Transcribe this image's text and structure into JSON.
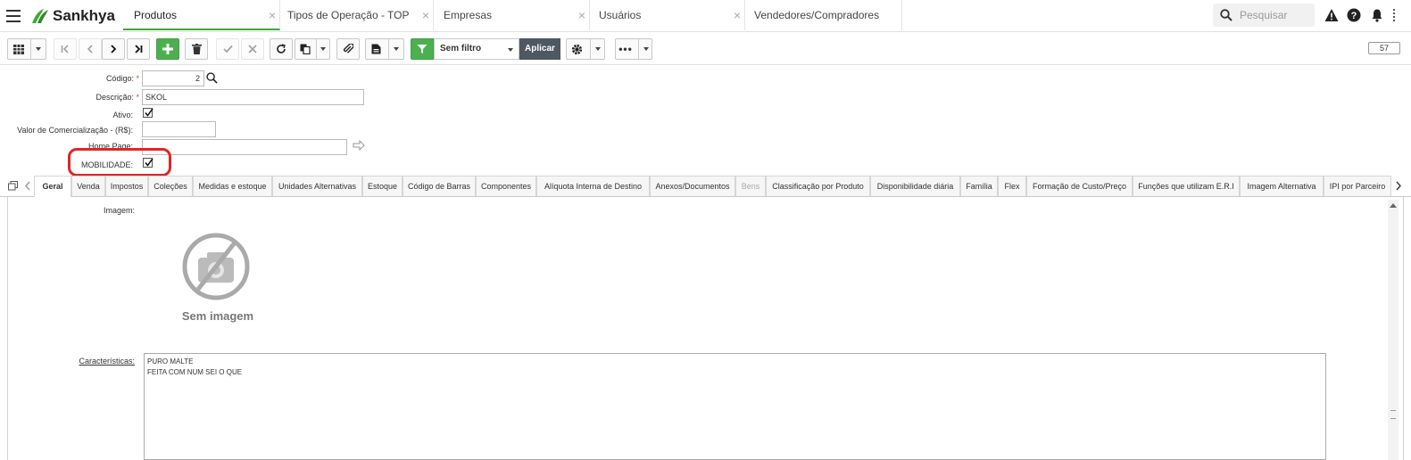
{
  "app": {
    "brand": "Sankhya",
    "brand_color": "#3aaa35"
  },
  "tabs": [
    {
      "label": "Produtos",
      "active": true
    },
    {
      "label": "Tipos de Operação - TOP"
    },
    {
      "label": "Empresas"
    },
    {
      "label": "Usuários"
    },
    {
      "label": "Vendedores/Compradores"
    }
  ],
  "search": {
    "placeholder": "Pesquisar"
  },
  "toolbar": {
    "filter_value": "Sem filtro",
    "apply_label": "Aplicar",
    "record_count": "57"
  },
  "form": {
    "codigo_label": "Código:",
    "codigo_value": "2",
    "descricao_label": "Descrição:",
    "descricao_value": "SKOL",
    "ativo_label": "Ativo:",
    "ativo_checked": true,
    "valor_label": "Valor de Comercialização - (R$):",
    "valor_value": "",
    "homepage_label": "Home Page:",
    "homepage_value": "",
    "mobilidade_label": "MOBILIDADE:",
    "mobilidade_checked": true
  },
  "subtabs": [
    {
      "label": "Geral",
      "active": true
    },
    {
      "label": "Venda"
    },
    {
      "label": "Impostos"
    },
    {
      "label": "Coleções"
    },
    {
      "label": "Medidas e estoque"
    },
    {
      "label": "Unidades Alternativas"
    },
    {
      "label": "Estoque"
    },
    {
      "label": "Código de Barras"
    },
    {
      "label": "Componentes"
    },
    {
      "label": "Alíquota Interna de Destino"
    },
    {
      "label": "Anexos/Documentos"
    },
    {
      "label": "Bens",
      "disabled": true
    },
    {
      "label": "Classificação por Produto"
    },
    {
      "label": "Disponibilidade diária"
    },
    {
      "label": "Família"
    },
    {
      "label": "Flex"
    },
    {
      "label": "Formação de Custo/Preço"
    },
    {
      "label": "Funções que utilizam E.R.I"
    },
    {
      "label": "Imagem Alternativa"
    },
    {
      "label": "IPI por Parceiro"
    }
  ],
  "general": {
    "imagem_label": "Imagem:",
    "no_image_text": "Sem imagem",
    "caracteristicas_label": "Características:",
    "caracteristicas_line1": "PURO MALTE",
    "caracteristicas_line2": "FEITA COM NUM SEI O QUE"
  }
}
